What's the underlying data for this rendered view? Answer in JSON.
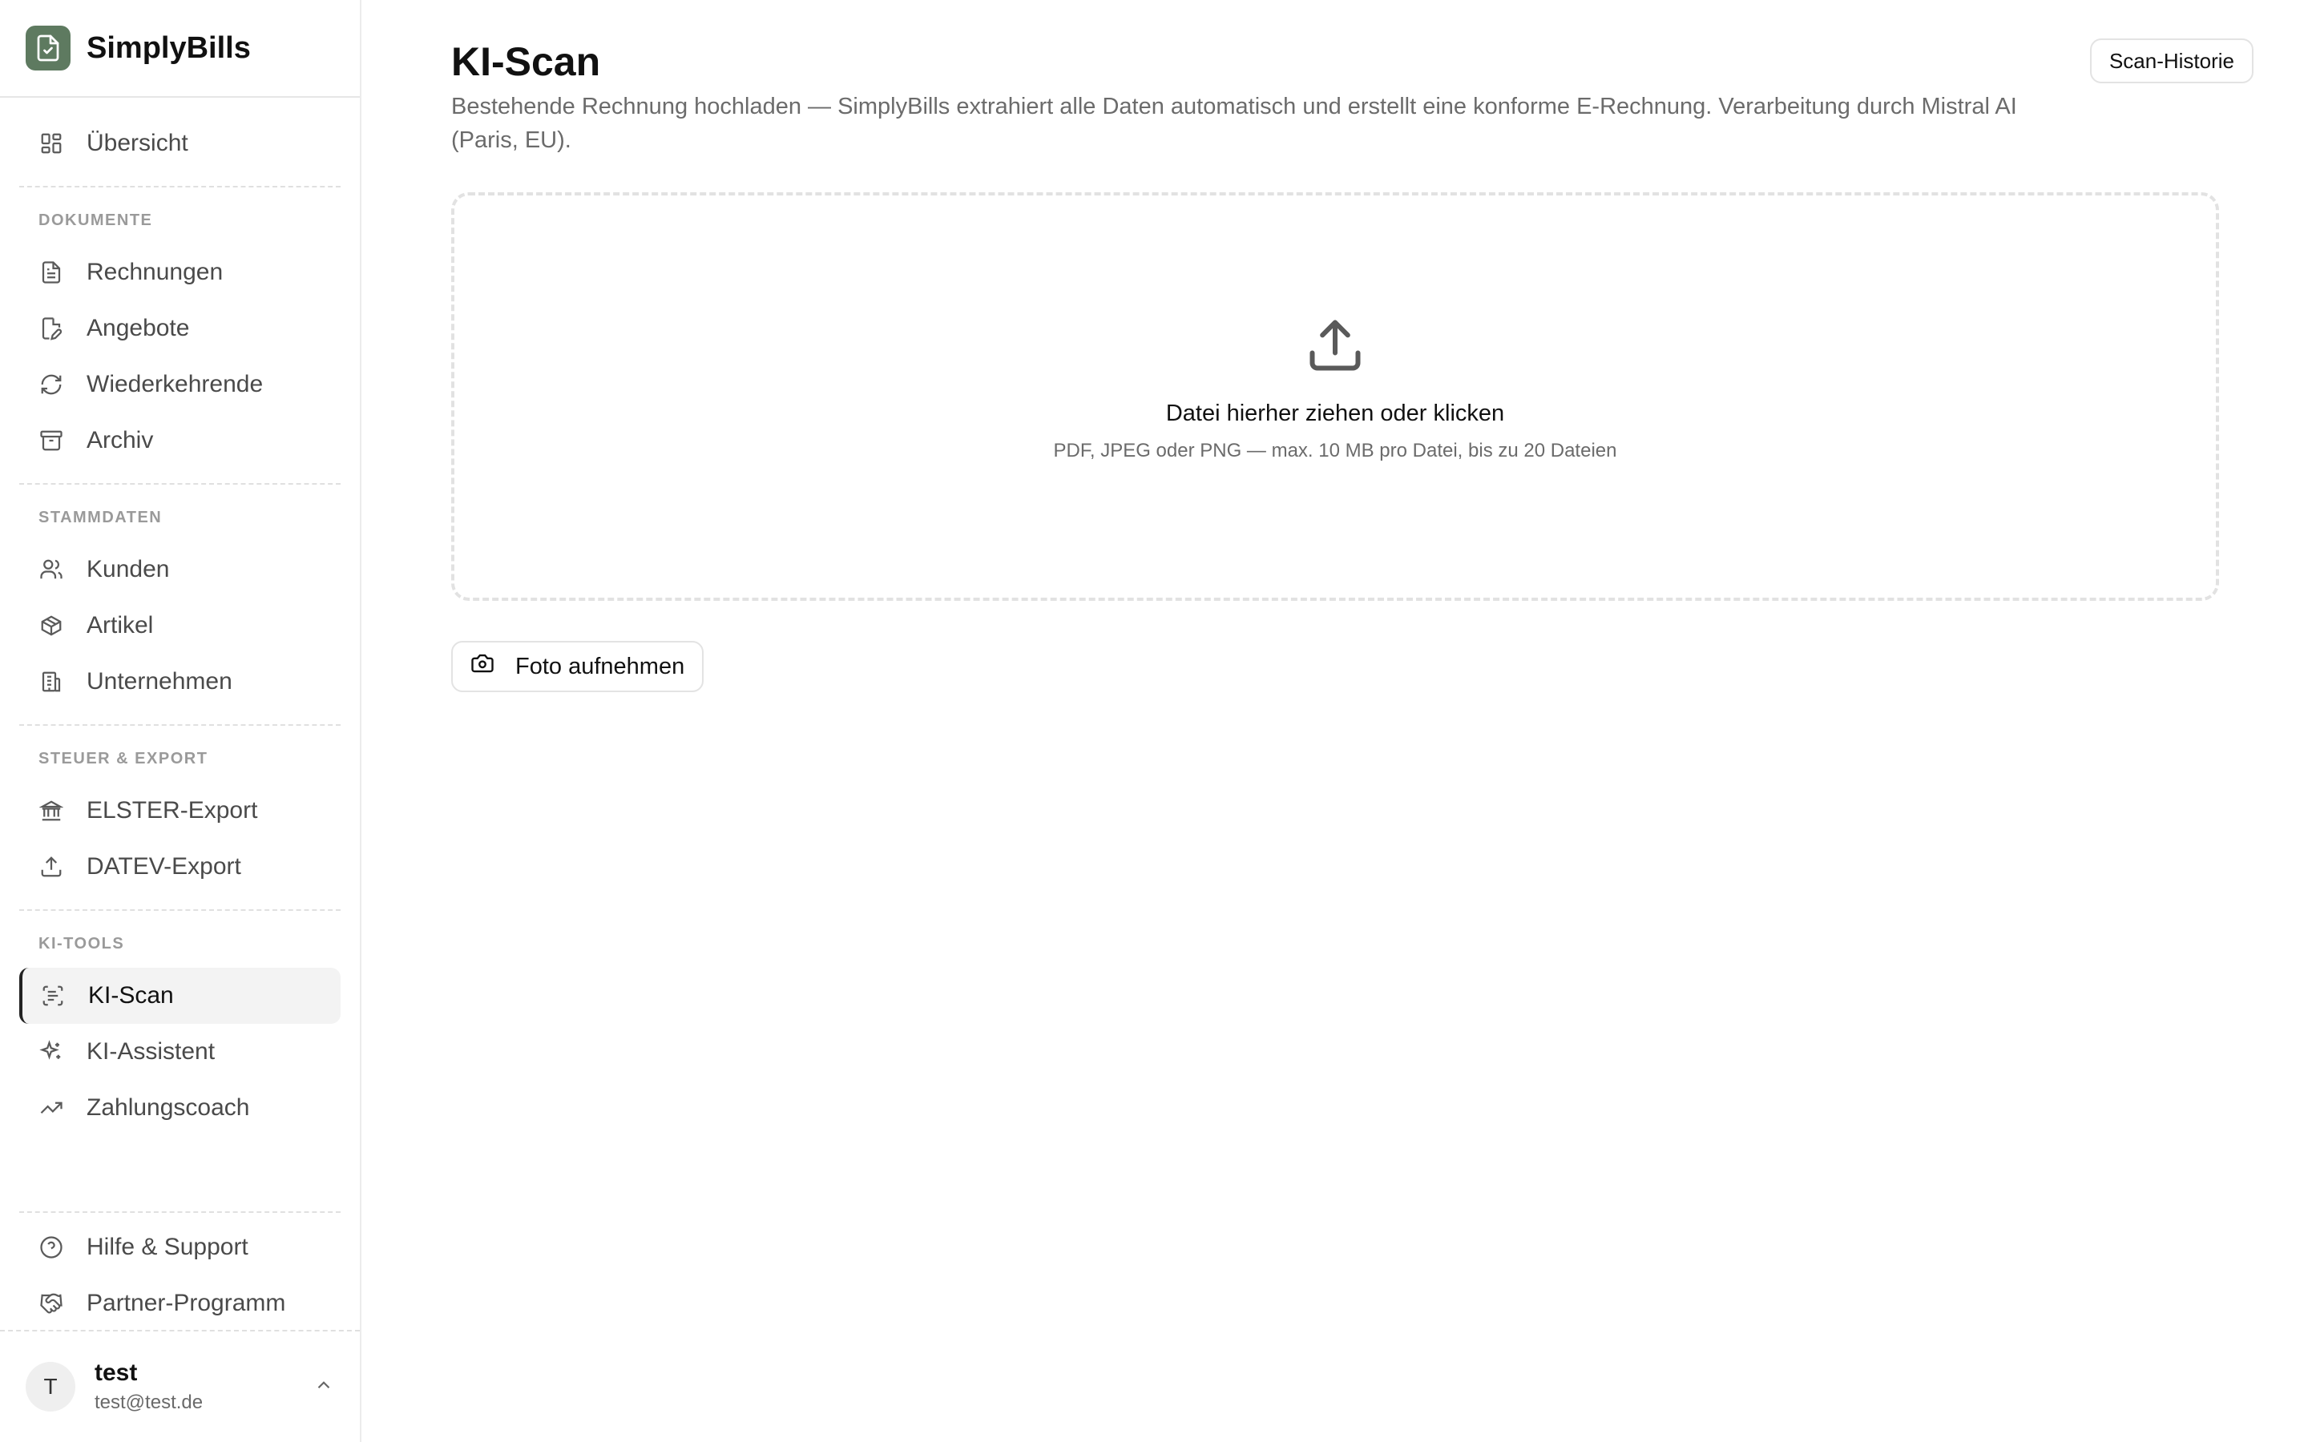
{
  "brand": {
    "name": "SimplyBills",
    "color": "#5e7a60"
  },
  "sidebar": {
    "overview": {
      "label": "Übersicht",
      "icon": "dashboard-grid-icon"
    },
    "sections": [
      {
        "label": "DOKUMENTE",
        "items": [
          {
            "label": "Rechnungen",
            "icon": "document-icon"
          },
          {
            "label": "Angebote",
            "icon": "document-edit-icon"
          },
          {
            "label": "Wiederkehrende",
            "icon": "refresh-icon"
          },
          {
            "label": "Archiv",
            "icon": "archive-icon"
          }
        ]
      },
      {
        "label": "STAMMDATEN",
        "items": [
          {
            "label": "Kunden",
            "icon": "users-icon"
          },
          {
            "label": "Artikel",
            "icon": "package-icon"
          },
          {
            "label": "Unternehmen",
            "icon": "building-icon"
          }
        ]
      },
      {
        "label": "STEUER & EXPORT",
        "items": [
          {
            "label": "ELSTER-Export",
            "icon": "bank-icon"
          },
          {
            "label": "DATEV-Export",
            "icon": "upload-icon"
          }
        ]
      },
      {
        "label": "KI-TOOLS",
        "items": [
          {
            "label": "KI-Scan",
            "icon": "scan-text-icon",
            "active": true
          },
          {
            "label": "KI-Assistent",
            "icon": "sparkles-icon"
          },
          {
            "label": "Zahlungscoach",
            "icon": "trending-up-icon"
          }
        ]
      }
    ],
    "bottom": [
      {
        "label": "Hilfe & Support",
        "icon": "help-circle-icon"
      },
      {
        "label": "Partner-Programm",
        "icon": "handshake-icon"
      }
    ],
    "user": {
      "initial": "T",
      "name": "test",
      "email": "test@test.de"
    }
  },
  "main": {
    "title": "KI-Scan",
    "subtitle": "Bestehende Rechnung hochladen — SimplyBills extrahiert alle Daten automatisch und erstellt eine konforme E-Rechnung. Verarbeitung durch Mistral AI (Paris, EU).",
    "history_button": "Scan-Historie",
    "dropzone": {
      "title": "Datei hierher ziehen oder klicken",
      "hint": "PDF, JPEG oder PNG — max. 10 MB pro Datei, bis zu 20 Dateien"
    },
    "photo_button": "Foto aufnehmen"
  }
}
